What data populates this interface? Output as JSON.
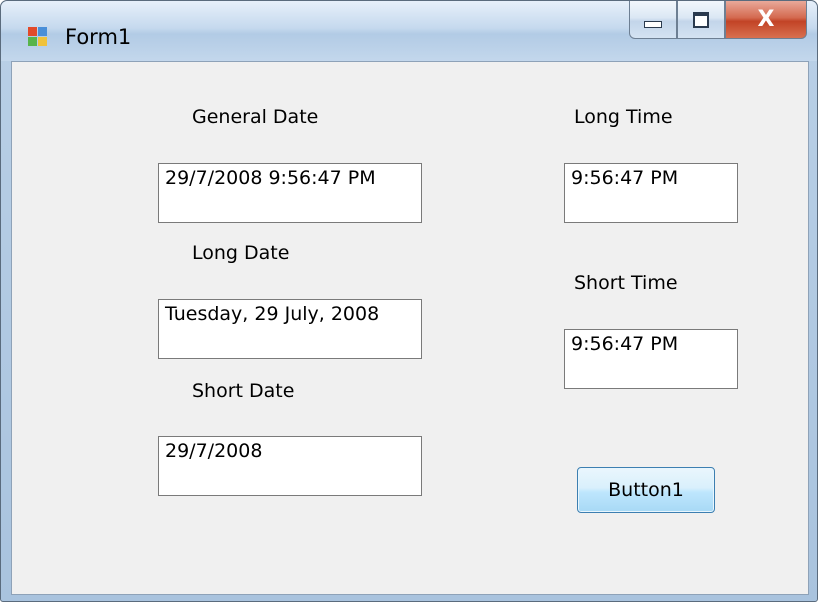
{
  "window": {
    "title": "Form1",
    "caption_buttons": {
      "minimize": "minimize",
      "maximize": "maximize",
      "close": "X"
    }
  },
  "form": {
    "general_date": {
      "label": "General Date",
      "value": "29/7/2008 9:56:47 PM"
    },
    "long_date": {
      "label": "Long Date",
      "value": "Tuesday, 29 July, 2008"
    },
    "short_date": {
      "label": "Short Date",
      "value": "29/7/2008"
    },
    "long_time": {
      "label": "Long Time",
      "value": "9:56:47 PM"
    },
    "short_time": {
      "label": "Short Time",
      "value": "9:56:47 PM"
    },
    "button_label": "Button1"
  },
  "icons": [
    "app-icon",
    "minimize-icon",
    "maximize-icon",
    "close-icon"
  ],
  "colors": {
    "client_bg": "#f0f0f0",
    "close_button": "#c24326",
    "button_border": "#3c7fb1"
  }
}
